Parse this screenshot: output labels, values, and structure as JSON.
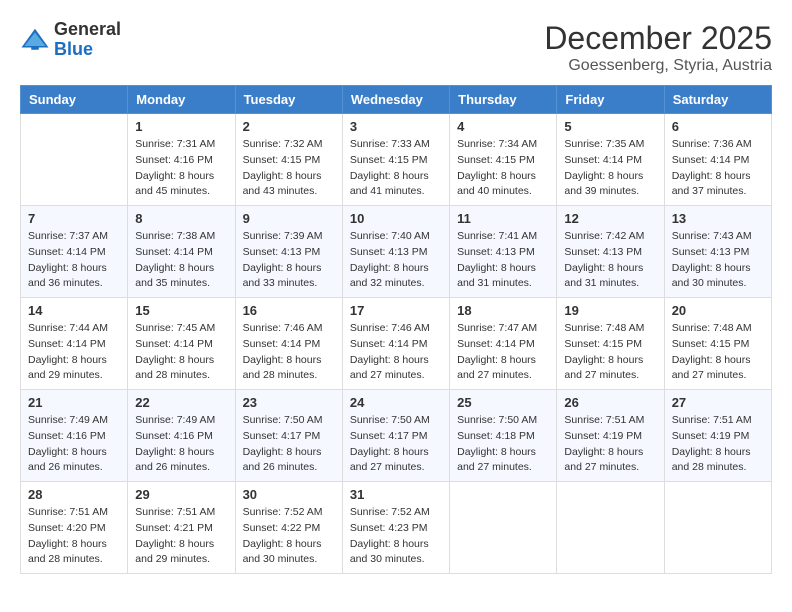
{
  "logo": {
    "general": "General",
    "blue": "Blue"
  },
  "header": {
    "month": "December 2025",
    "location": "Goessenberg, Styria, Austria"
  },
  "days_of_week": [
    "Sunday",
    "Monday",
    "Tuesday",
    "Wednesday",
    "Thursday",
    "Friday",
    "Saturday"
  ],
  "weeks": [
    [
      {
        "day": "",
        "info": ""
      },
      {
        "day": "1",
        "info": "Sunrise: 7:31 AM\nSunset: 4:16 PM\nDaylight: 8 hours\nand 45 minutes."
      },
      {
        "day": "2",
        "info": "Sunrise: 7:32 AM\nSunset: 4:15 PM\nDaylight: 8 hours\nand 43 minutes."
      },
      {
        "day": "3",
        "info": "Sunrise: 7:33 AM\nSunset: 4:15 PM\nDaylight: 8 hours\nand 41 minutes."
      },
      {
        "day": "4",
        "info": "Sunrise: 7:34 AM\nSunset: 4:15 PM\nDaylight: 8 hours\nand 40 minutes."
      },
      {
        "day": "5",
        "info": "Sunrise: 7:35 AM\nSunset: 4:14 PM\nDaylight: 8 hours\nand 39 minutes."
      },
      {
        "day": "6",
        "info": "Sunrise: 7:36 AM\nSunset: 4:14 PM\nDaylight: 8 hours\nand 37 minutes."
      }
    ],
    [
      {
        "day": "7",
        "info": "Sunrise: 7:37 AM\nSunset: 4:14 PM\nDaylight: 8 hours\nand 36 minutes."
      },
      {
        "day": "8",
        "info": "Sunrise: 7:38 AM\nSunset: 4:14 PM\nDaylight: 8 hours\nand 35 minutes."
      },
      {
        "day": "9",
        "info": "Sunrise: 7:39 AM\nSunset: 4:13 PM\nDaylight: 8 hours\nand 33 minutes."
      },
      {
        "day": "10",
        "info": "Sunrise: 7:40 AM\nSunset: 4:13 PM\nDaylight: 8 hours\nand 32 minutes."
      },
      {
        "day": "11",
        "info": "Sunrise: 7:41 AM\nSunset: 4:13 PM\nDaylight: 8 hours\nand 31 minutes."
      },
      {
        "day": "12",
        "info": "Sunrise: 7:42 AM\nSunset: 4:13 PM\nDaylight: 8 hours\nand 31 minutes."
      },
      {
        "day": "13",
        "info": "Sunrise: 7:43 AM\nSunset: 4:13 PM\nDaylight: 8 hours\nand 30 minutes."
      }
    ],
    [
      {
        "day": "14",
        "info": "Sunrise: 7:44 AM\nSunset: 4:14 PM\nDaylight: 8 hours\nand 29 minutes."
      },
      {
        "day": "15",
        "info": "Sunrise: 7:45 AM\nSunset: 4:14 PM\nDaylight: 8 hours\nand 28 minutes."
      },
      {
        "day": "16",
        "info": "Sunrise: 7:46 AM\nSunset: 4:14 PM\nDaylight: 8 hours\nand 28 minutes."
      },
      {
        "day": "17",
        "info": "Sunrise: 7:46 AM\nSunset: 4:14 PM\nDaylight: 8 hours\nand 27 minutes."
      },
      {
        "day": "18",
        "info": "Sunrise: 7:47 AM\nSunset: 4:14 PM\nDaylight: 8 hours\nand 27 minutes."
      },
      {
        "day": "19",
        "info": "Sunrise: 7:48 AM\nSunset: 4:15 PM\nDaylight: 8 hours\nand 27 minutes."
      },
      {
        "day": "20",
        "info": "Sunrise: 7:48 AM\nSunset: 4:15 PM\nDaylight: 8 hours\nand 27 minutes."
      }
    ],
    [
      {
        "day": "21",
        "info": "Sunrise: 7:49 AM\nSunset: 4:16 PM\nDaylight: 8 hours\nand 26 minutes."
      },
      {
        "day": "22",
        "info": "Sunrise: 7:49 AM\nSunset: 4:16 PM\nDaylight: 8 hours\nand 26 minutes."
      },
      {
        "day": "23",
        "info": "Sunrise: 7:50 AM\nSunset: 4:17 PM\nDaylight: 8 hours\nand 26 minutes."
      },
      {
        "day": "24",
        "info": "Sunrise: 7:50 AM\nSunset: 4:17 PM\nDaylight: 8 hours\nand 27 minutes."
      },
      {
        "day": "25",
        "info": "Sunrise: 7:50 AM\nSunset: 4:18 PM\nDaylight: 8 hours\nand 27 minutes."
      },
      {
        "day": "26",
        "info": "Sunrise: 7:51 AM\nSunset: 4:19 PM\nDaylight: 8 hours\nand 27 minutes."
      },
      {
        "day": "27",
        "info": "Sunrise: 7:51 AM\nSunset: 4:19 PM\nDaylight: 8 hours\nand 28 minutes."
      }
    ],
    [
      {
        "day": "28",
        "info": "Sunrise: 7:51 AM\nSunset: 4:20 PM\nDaylight: 8 hours\nand 28 minutes."
      },
      {
        "day": "29",
        "info": "Sunrise: 7:51 AM\nSunset: 4:21 PM\nDaylight: 8 hours\nand 29 minutes."
      },
      {
        "day": "30",
        "info": "Sunrise: 7:52 AM\nSunset: 4:22 PM\nDaylight: 8 hours\nand 30 minutes."
      },
      {
        "day": "31",
        "info": "Sunrise: 7:52 AM\nSunset: 4:23 PM\nDaylight: 8 hours\nand 30 minutes."
      },
      {
        "day": "",
        "info": ""
      },
      {
        "day": "",
        "info": ""
      },
      {
        "day": "",
        "info": ""
      }
    ]
  ]
}
